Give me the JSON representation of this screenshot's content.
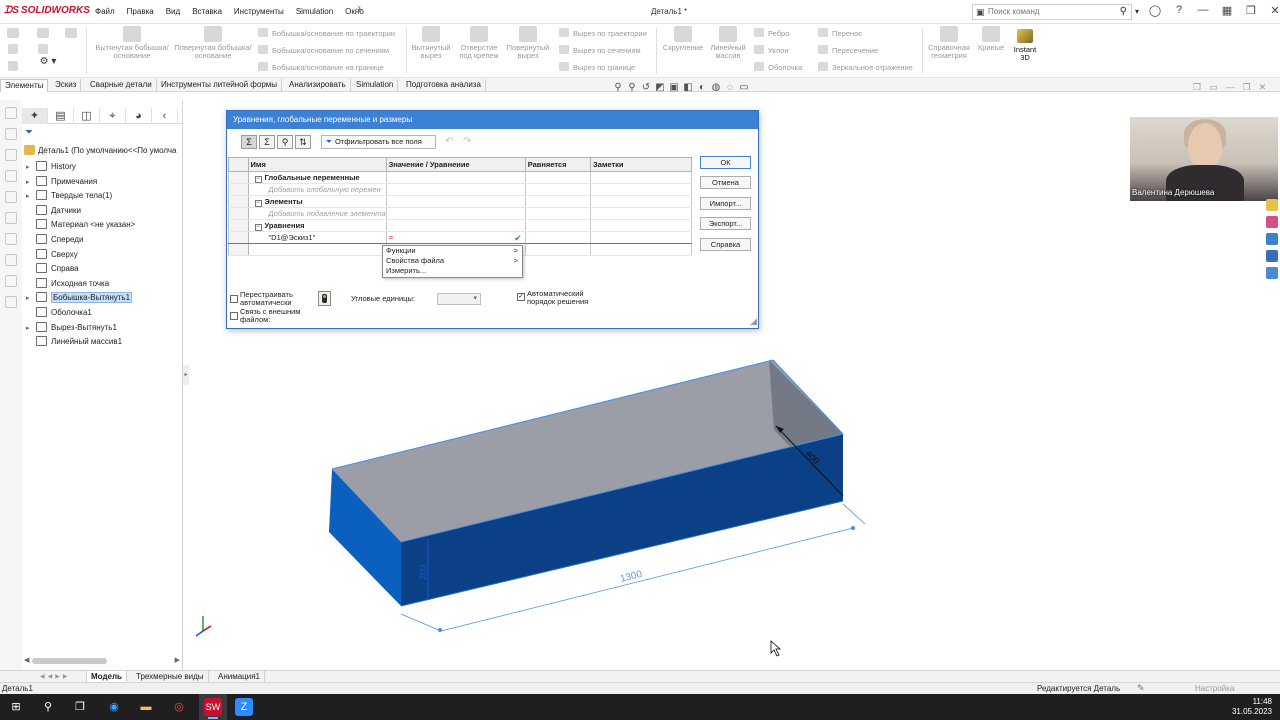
{
  "app": {
    "logo": "SOLIDWORKS",
    "document_title": "Деталь1 *"
  },
  "menu": [
    "Файл",
    "Правка",
    "Вид",
    "Вставка",
    "Инструменты",
    "Simulation",
    "Окно"
  ],
  "command_search": {
    "placeholder": "Поиск команд"
  },
  "command_manager": {
    "extruded_boss": "Вытянутая бобышка/основание",
    "revolved_boss": "Повернутая бобышка/основание",
    "swept_boss": "Бобышка/основание по траектории",
    "lofted_boss": "Бобышка/основание по сечениям",
    "boundary_boss": "Бобышка/основание на границе",
    "extruded_cut": "Вытянутый вырез",
    "hole_wizard": "Отверстие под крепеж",
    "revolved_cut": "Повернутый вырез",
    "swept_cut": "Вырез по траектории",
    "lofted_cut": "Вырез по сечениям",
    "boundary_cut": "Вырез по границе",
    "fillet": "Скругление",
    "linear_pattern": "Линейный массив",
    "rib": "Ребро",
    "draft": "Уклон",
    "shell": "Оболочка",
    "wrap": "Перенос",
    "intersect": "Пересечение",
    "mirror": "Зеркальное отражение",
    "ref_geometry": "Справочная геометрия",
    "curves": "Кривые",
    "instant3d": "Instant 3D"
  },
  "tabs": [
    "Элементы",
    "Эскиз",
    "Сварные детали",
    "Инструменты литейной формы",
    "Анализировать",
    "Simulation",
    "Подготовка анализа"
  ],
  "feature_tree": {
    "root": "Деталь1  (По умолчанию<<По умолча",
    "items": [
      {
        "label": "History",
        "expand": true
      },
      {
        "label": "Примечания",
        "expand": true
      },
      {
        "label": "Твердые тела(1)",
        "expand": true
      },
      {
        "label": "Датчики",
        "expand": false
      },
      {
        "label": "Материал <не указан>",
        "expand": false
      },
      {
        "label": "Спереди",
        "expand": false
      },
      {
        "label": "Сверху",
        "expand": false
      },
      {
        "label": "Справа",
        "expand": false
      },
      {
        "label": "Исходная точка",
        "expand": false
      },
      {
        "label": "Бобышка-Вытянуть1",
        "expand": true,
        "selected": true
      },
      {
        "label": "Оболочка1",
        "expand": false
      },
      {
        "label": "Вырез-Вытянуть1",
        "expand": true
      },
      {
        "label": "Линейный массив1",
        "expand": false
      }
    ]
  },
  "dialog": {
    "title": "Уравнения, глобальные переменные и размеры",
    "filter_label": "Отфильтровать все поля",
    "columns": [
      "Имя",
      "Значение / Уравнение",
      "Равняется",
      "Заметки"
    ],
    "sections": {
      "globals": "Глобальные переменные",
      "add_global": "Добавить глобальную перемен",
      "features": "Элементы",
      "add_feature": "Добавить подавление элемента",
      "equations": "Уравнения"
    },
    "equation_row": {
      "name": "\"D1@Эскиз1\"",
      "value": "="
    },
    "context_menu": [
      {
        "label": "Функции",
        "submenu": true
      },
      {
        "label": "Свойства файла",
        "submenu": true
      },
      {
        "label": "Измерить...",
        "submenu": false
      }
    ],
    "buttons": {
      "ok": "ОК",
      "cancel": "Отмена",
      "import": "Импорт...",
      "export": "Экспорт...",
      "help": "Справка"
    },
    "options": {
      "auto_rebuild": "Перестраивать автоматически",
      "link_external": "Связь с внешним файлом:",
      "angular_units": "Угловые единицы:",
      "auto_solve": "Автоматический порядок решения"
    }
  },
  "model": {
    "dim_length": "1300",
    "dim_height": "200",
    "dim_depth": "400",
    "colors": {
      "side_blue": "#0a5fbf",
      "front_blue": "#0b3f86",
      "top_grey": "#9b9ea6"
    }
  },
  "webcam": {
    "name": "Валентина Дерюшева"
  },
  "bottom_tabs": [
    "Модель",
    "Трехмерные виды",
    "Анимация1"
  ],
  "status": {
    "document": "Деталь1",
    "editing": "Редактируется Деталь",
    "config": "Настройка"
  },
  "clock": {
    "time": "11:48",
    "date": "31.05.2023"
  }
}
